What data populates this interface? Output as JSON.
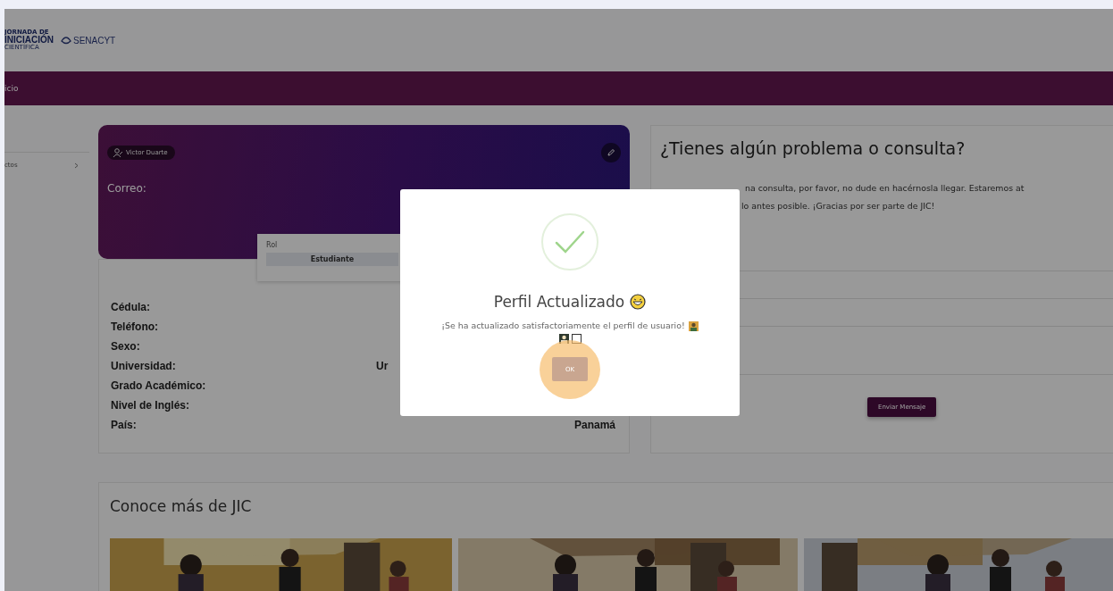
{
  "header": {
    "logo_lines": [
      "JORNADA DE",
      "INICIACIÓN",
      "CIENTÍFICA"
    ],
    "partner": "SENACYT"
  },
  "nav": {
    "item": "icio"
  },
  "sidebar": {
    "items": [
      {
        "label": "ctos"
      }
    ]
  },
  "profile": {
    "name": "Victor Duarte",
    "email_label": "Correo:",
    "role_popup": {
      "label": "Rol",
      "value": "Estudiante"
    }
  },
  "details": [
    {
      "label": "Cédula:"
    },
    {
      "label": "Teléfono:"
    },
    {
      "label": "Sexo:"
    },
    {
      "label": "Universidad:",
      "value": "Ur",
      "kind": "long"
    },
    {
      "label": "Grado Académico:"
    },
    {
      "label": "Nivel de Inglés:"
    },
    {
      "label": "País:",
      "value": "Panamá",
      "kind": "short"
    }
  ],
  "contact": {
    "title": "¿Tienes algún problema o consulta?",
    "paragraph_lines": [
      "na consulta, por favor, no dude en hacérnosla llegar. Estaremos at",
      "lo antes posible. ¡Gracias por ser parte de JIC!"
    ],
    "fields": [
      {
        "kind": "line"
      },
      {
        "kind": "line"
      },
      {
        "kind": "line"
      },
      {
        "kind": "area"
      }
    ],
    "button": "Enviar Mensaje"
  },
  "gallery": {
    "title": "Conoce más de JIC"
  },
  "dialog": {
    "title": "Perfil Actualizado",
    "message": "¡Se ha actualizado satisfactoriamente el perfil de usuario!",
    "button": "OK"
  }
}
